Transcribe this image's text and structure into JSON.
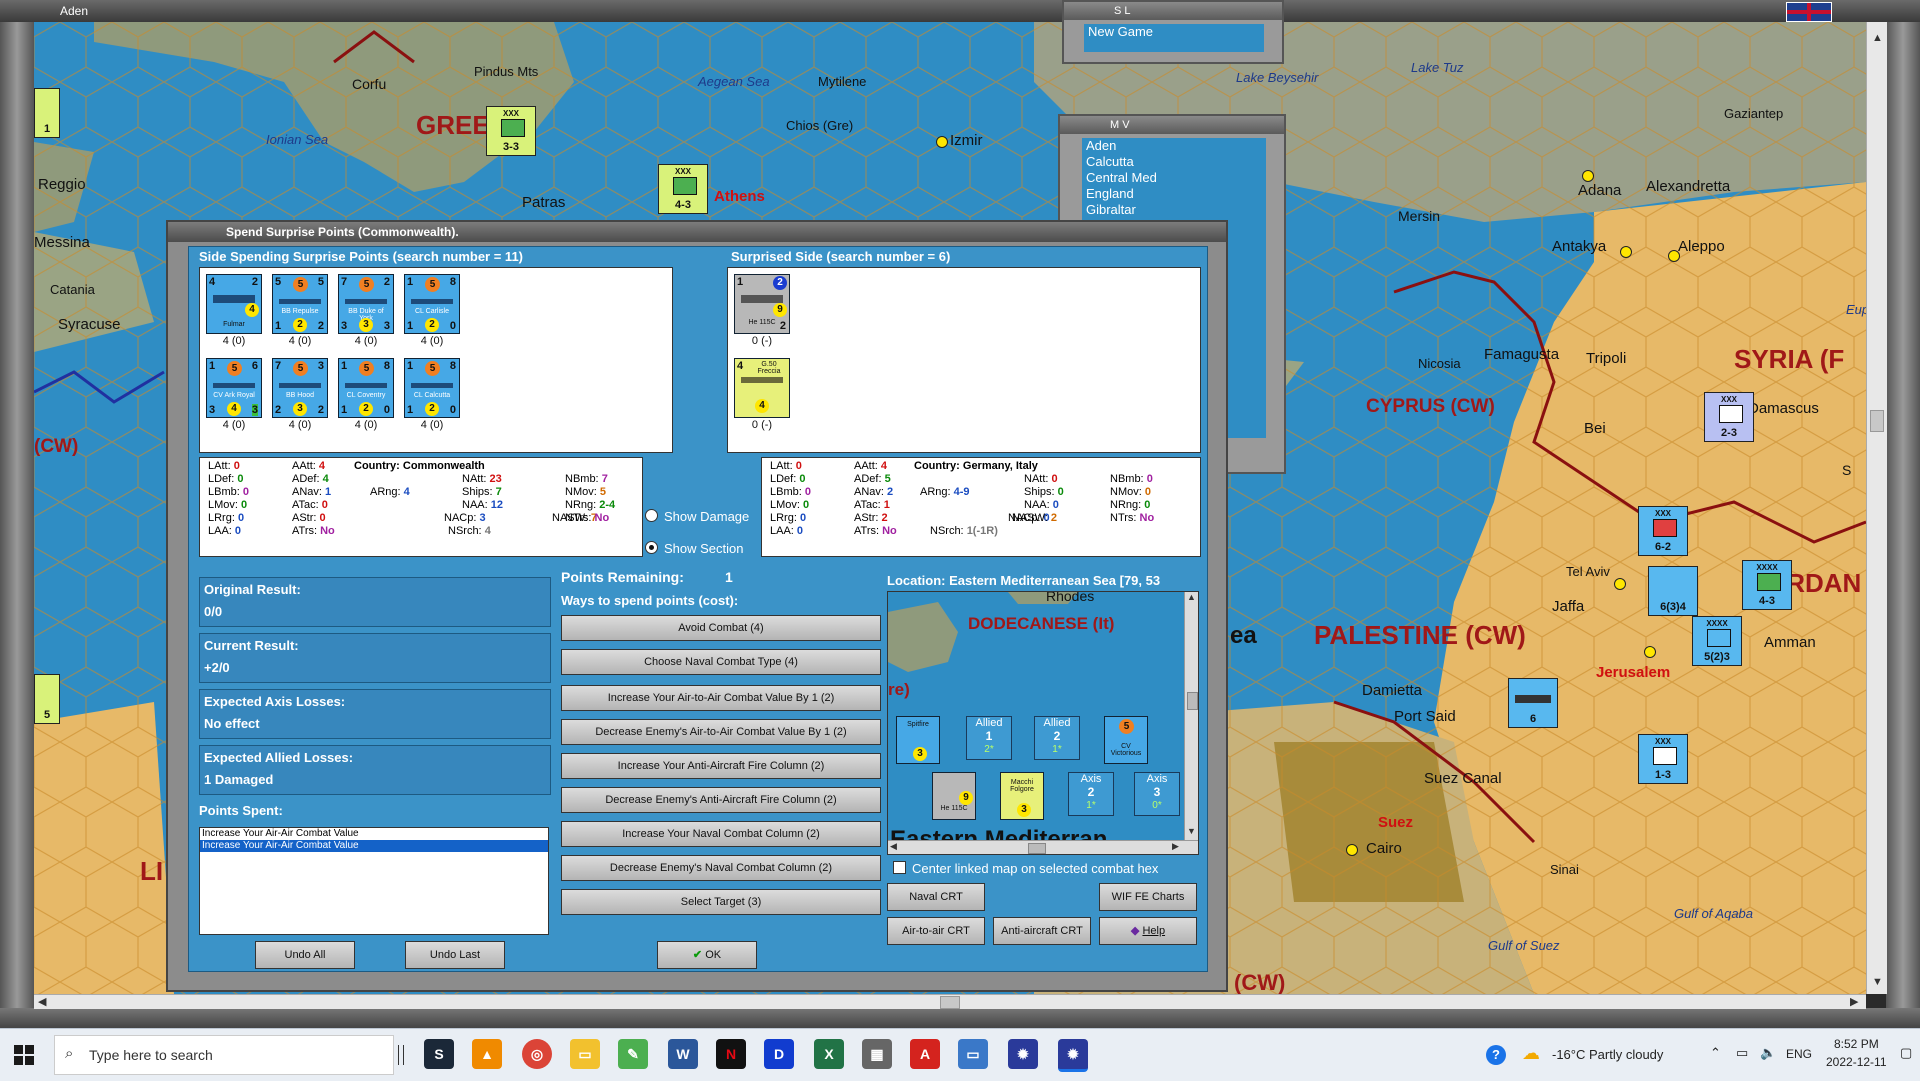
{
  "app": {
    "title": "Aden"
  },
  "windows": {
    "sl": {
      "title": "S L",
      "items": [
        "New Game"
      ]
    },
    "mv": {
      "title": "M V",
      "items": [
        "Aden",
        "Calcutta",
        "Central Med",
        "England",
        "Gibraltar"
      ]
    }
  },
  "map": {
    "labels": [
      "Pindus Mts",
      "Corfu",
      "Aegean Sea",
      "Mytilene",
      "Lake Tuz",
      "Lake Beysehir",
      "Gaziantep",
      "Ionian Sea",
      "Chios (Gre)",
      "Izmir",
      "Adana",
      "Alexandretta",
      "Reggio",
      "Patras",
      "Mersin",
      "Aleppo",
      "Antakya",
      "Messina",
      "Catania",
      "Syracuse",
      "Nicosia",
      "Famagusta",
      "Tripoli",
      "Damascus",
      "Bei",
      "Tel Aviv",
      "Jaffa",
      "Amman",
      "Damietta",
      "Port Said",
      "Suez Canal",
      "Cairo",
      "Sinai",
      "Gulf of Aqaba",
      "Gulf of Suez",
      "ea",
      "Eup",
      "S"
    ],
    "countries": [
      "GREE",
      "CYPRUS (CW)",
      "SYRIA (F",
      "PALESTINE (CW)",
      "ORDAN",
      "(CW)",
      "LI",
      "(CW)"
    ],
    "capitals": [
      "Athens",
      "Jerusalem",
      "Suez"
    ],
    "counters": [
      {
        "top": "XXX",
        "val": "3-3"
      },
      {
        "top": "XXX",
        "val": "4-3"
      },
      {
        "top": "XXX",
        "val": "2-3"
      },
      {
        "top": "XXX",
        "val": "6-2"
      },
      {
        "top": "XXXX",
        "val": "4-3"
      },
      {
        "top": "XXXX",
        "val": "5(2)3"
      },
      {
        "top": "XXX",
        "val": "1-3"
      },
      {
        "top": "",
        "val": "6(3)4"
      },
      {
        "top": "",
        "val": "6"
      },
      {
        "top": "",
        "val": "1"
      },
      {
        "top": "",
        "val": "5"
      }
    ]
  },
  "dialog": {
    "title": "Spend Surprise Points (Commonwealth).",
    "side_spending": {
      "heading": "Side Spending Surprise Points (search number = 11)",
      "units": [
        {
          "name": "Fulmar",
          "tl": "4",
          "tr": "2",
          "bl": "",
          "br": "4",
          "cap": "4 (0)"
        },
        {
          "name": "BB Repulse",
          "tl": "5",
          "tr": "5",
          "bl": "1",
          "br": "2",
          "mid": "2",
          "cap": "4 (0)"
        },
        {
          "name": "BB Duke of York",
          "tl": "7",
          "tr": "2",
          "bl": "3",
          "br": "3",
          "mid": "3",
          "cap": "4 (0)"
        },
        {
          "name": "CL Carlisle",
          "tl": "1",
          "tr": "8",
          "bl": "1",
          "br": "0",
          "mid": "2",
          "cap": "4 (0)"
        },
        {
          "name": "CV Ark Royal",
          "tl": "1",
          "tr": "6",
          "bl": "3",
          "br": "3",
          "mid": "4",
          "cap": "4 (0)"
        },
        {
          "name": "BB Hood",
          "tl": "7",
          "tr": "3",
          "bl": "2",
          "br": "2",
          "mid": "3",
          "cap": "4 (0)"
        },
        {
          "name": "CL Coventry",
          "tl": "1",
          "tr": "8",
          "bl": "1",
          "br": "0",
          "mid": "2",
          "cap": "4 (0)"
        },
        {
          "name": "CL Calcutta",
          "tl": "1",
          "tr": "8",
          "bl": "1",
          "br": "0",
          "mid": "2",
          "cap": "4 (0)"
        }
      ],
      "orange": [
        "",
        "5",
        "5",
        "5",
        "5",
        "5",
        "5",
        "5"
      ],
      "stats": {
        "country": "Country: Commonwealth",
        "latt": "0",
        "ldef": "0",
        "lbmb": "0",
        "lmov": "0",
        "lrg": "0",
        "laa": "0",
        "aatt": "4",
        "adef": "4",
        "anav": "1",
        "atac": "0",
        "astr": "0",
        "atrs": "No",
        "arng": "4",
        "natt": "23",
        "ships": "7",
        "naa": "12",
        "nacp": "3",
        "nasw": "7",
        "nsrch": "4",
        "nbmb": "7",
        "nmov": "5",
        "nrng": "2-4",
        "ntrs": "No"
      }
    },
    "surprised": {
      "heading": "Surprised Side (search number = 6)",
      "units": [
        {
          "name": "He 115C",
          "tl": "1",
          "tr": "2",
          "br": "2",
          "mid": "9",
          "cap": "0 (-)"
        },
        {
          "name": "G.50 Freccia",
          "tl": "4",
          "tr": "",
          "br": "",
          "mid": "4",
          "cap": "0 (-)"
        }
      ],
      "stats": {
        "country": "Country: Germany, Italy",
        "latt": "0",
        "ldef": "0",
        "lbmb": "0",
        "lmov": "0",
        "lrg": "0",
        "laa": "0",
        "aatt": "4",
        "adef": "5",
        "anav": "2",
        "atac": "1",
        "astr": "2",
        "atrs": "No",
        "arng": "4-9",
        "natt": "0",
        "ships": "0",
        "naa": "0",
        "nacp": "0",
        "nasw": "2",
        "nsrch": "1(-1R)",
        "nbmb": "0",
        "nmov": "0",
        "nrng": "0",
        "ntrs": "No"
      }
    },
    "options": {
      "show_damage": "Show Damage",
      "show_section": "Show Section"
    },
    "results": {
      "original_label": "Original Result:",
      "original_value": "0/0",
      "current_label": "Current Result:",
      "current_value": "+2/0",
      "axis_label": "Expected Axis Losses:",
      "axis_value": "No effect",
      "allied_label": "Expected Allied Losses:",
      "allied_value": "1 Damaged"
    },
    "points_spent": {
      "label": "Points Spent:",
      "items": [
        "Increase Your Air-Air Combat Value",
        "Increase Your Air-Air Combat Value"
      ]
    },
    "points_remaining_label": "Points Remaining:",
    "points_remaining_value": "1",
    "ways_label": "Ways to spend points (cost):",
    "spend_options": [
      "Avoid Combat (4)",
      "Choose Naval Combat Type (4)",
      "Increase Your Air-to-Air Combat Value By 1 (2)",
      "Decrease Enemy's Air-to-Air Combat Value By 1 (2)",
      "Increase Your Anti-Aircraft Fire Column (2)",
      "Decrease Enemy's Anti-Aircraft Fire Column (2)",
      "Increase Your Naval Combat Column (2)",
      "Decrease Enemy's Naval Combat Column (2)",
      "Select Target (3)"
    ],
    "location": "Location: Eastern Mediterranean Sea [79, 53",
    "minimap": {
      "top_label": "Rhodes",
      "region": "DODECANESE (It)",
      "left_frag": "re)",
      "bottom_label": "Eastern Mediterran",
      "allied": [
        {
          "label": "Allied",
          "num": "1",
          "sub": "2*"
        },
        {
          "label": "Allied",
          "num": "2",
          "sub": "1*"
        }
      ],
      "axis": [
        {
          "label": "Axis",
          "num": "2",
          "sub": "1*"
        },
        {
          "label": "Axis",
          "num": "3",
          "sub": "0*"
        }
      ],
      "units": [
        "Spitfire",
        "CV Victorious",
        "He 115C",
        "Macchi Folgore"
      ],
      "unit_vals": [
        "3",
        "5",
        "9",
        "3"
      ]
    },
    "center_check": "Center linked map on selected combat hex",
    "buttons": {
      "undo_all": "Undo All",
      "undo_last": "Undo Last",
      "ok": "OK",
      "naval_crt": "Naval CRT",
      "wif_fe": "WIF FE Charts",
      "air_crt": "Air-to-air CRT",
      "aa_crt": "Anti-aircraft CRT",
      "help": "Help"
    }
  },
  "taskbar": {
    "search_placeholder": "Type here to search",
    "weather": "-16°C  Partly cloudy",
    "lang": "ENG",
    "time": "8:52 PM",
    "date": "2022-12-11"
  }
}
